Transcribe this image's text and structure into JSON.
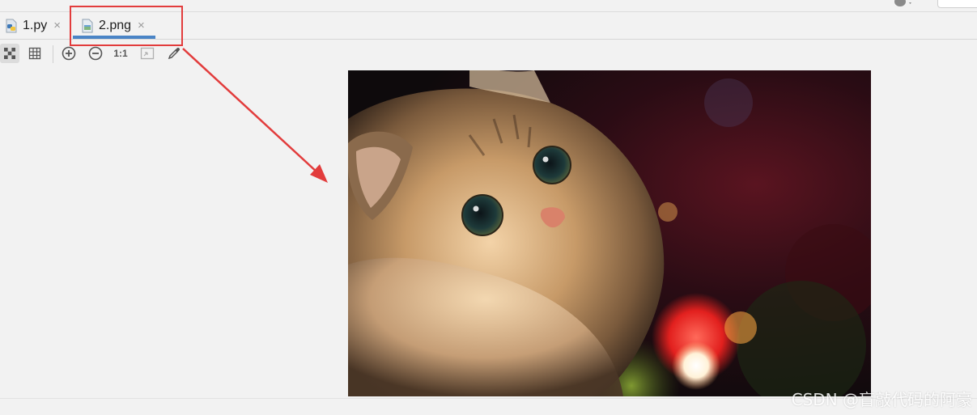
{
  "editor": {
    "tabs": [
      {
        "label": "1.py",
        "icon": "python-file-icon",
        "active": false
      },
      {
        "label": "2.png",
        "icon": "image-file-icon",
        "active": true
      }
    ],
    "close_glyph": "×"
  },
  "toolbar": {
    "buttons": [
      {
        "name": "chessboard-icon",
        "active": true
      },
      {
        "name": "grid-icon"
      },
      {
        "name": "zoom-in-icon"
      },
      {
        "name": "zoom-out-icon"
      },
      {
        "name": "actual-size-icon",
        "label": "1:1"
      },
      {
        "name": "fit-zoom-icon"
      },
      {
        "name": "color-picker-icon"
      }
    ]
  },
  "colors": {
    "annotation_red": "#e23c3c",
    "tab_underline": "#4a84c6",
    "background": "#f2f2f2"
  },
  "image_content": "cat-photo",
  "watermark": "CSDN @盲敲代码的阿豪"
}
